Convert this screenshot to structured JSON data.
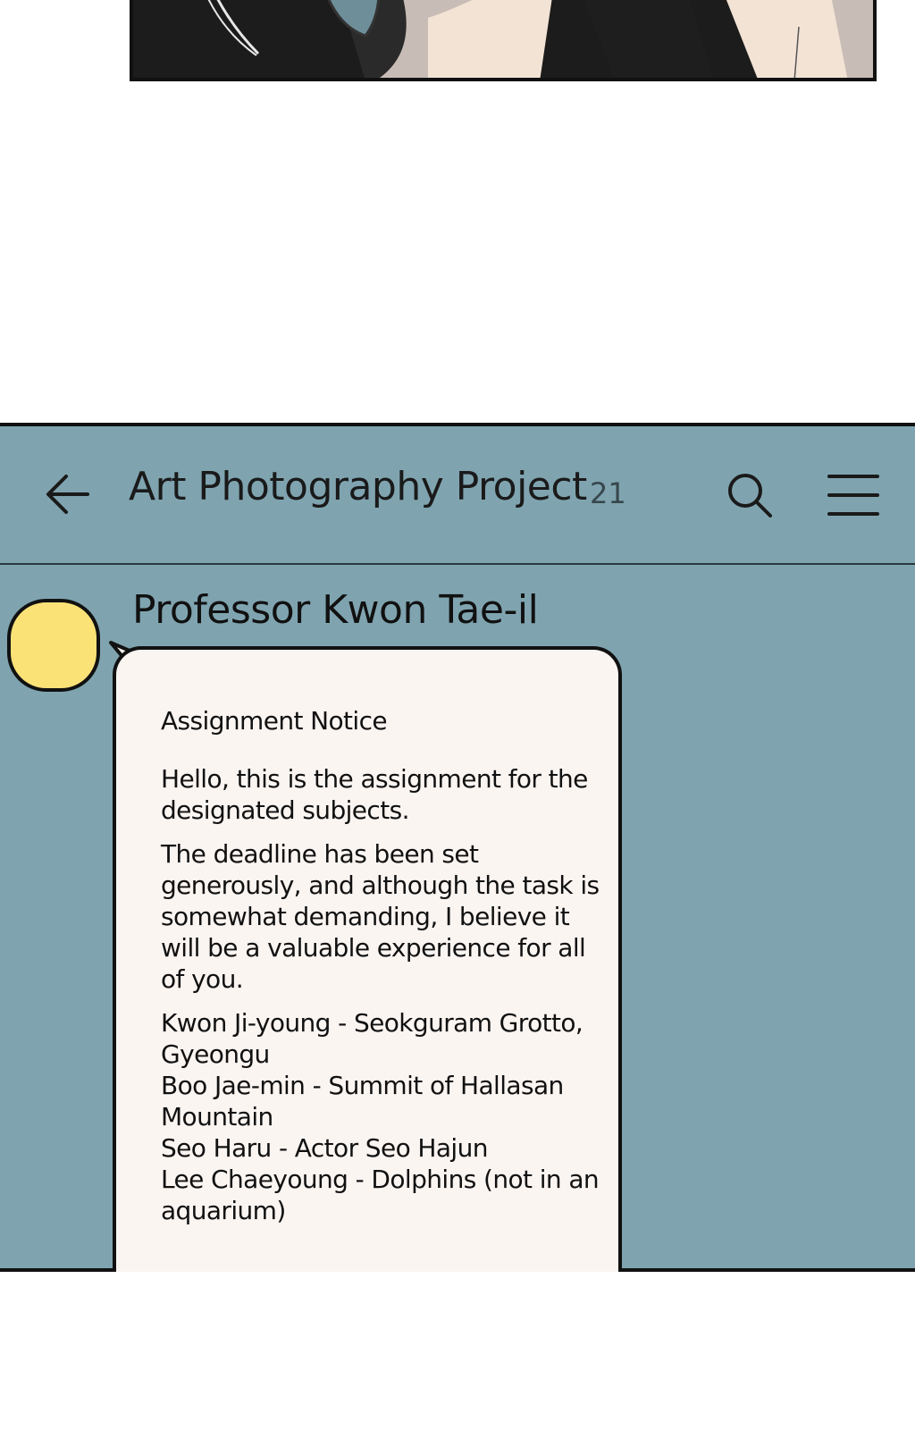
{
  "chat": {
    "title": "Art Photography Project",
    "member_count": "21",
    "icons": {
      "back": "arrow-left-icon",
      "search": "search-icon",
      "menu": "hamburger-menu-icon"
    }
  },
  "message": {
    "sender": "Professor Kwon Tae-il",
    "heading": "Assignment Notice",
    "greeting": "Hello, this is the assignment for the designated subjects.",
    "body": "The deadline has been set generously, and although the task is somewhat demanding, I believe it will be a valuable experience for all of you.",
    "assignments": [
      "Kwon Ji-young - Seokguram Grotto, Gyeongu",
      "Boo Jae-min - Summit of Hallasan Mountain",
      "Seo Haru - Actor Seo Hajun",
      "Lee Chaeyoung - Dolphins (not in an aquarium)"
    ]
  },
  "colors": {
    "chat_background": "#7fa4b0",
    "bubble": "#fbf5f2",
    "avatar": "#fbe277",
    "outline": "#111111"
  }
}
